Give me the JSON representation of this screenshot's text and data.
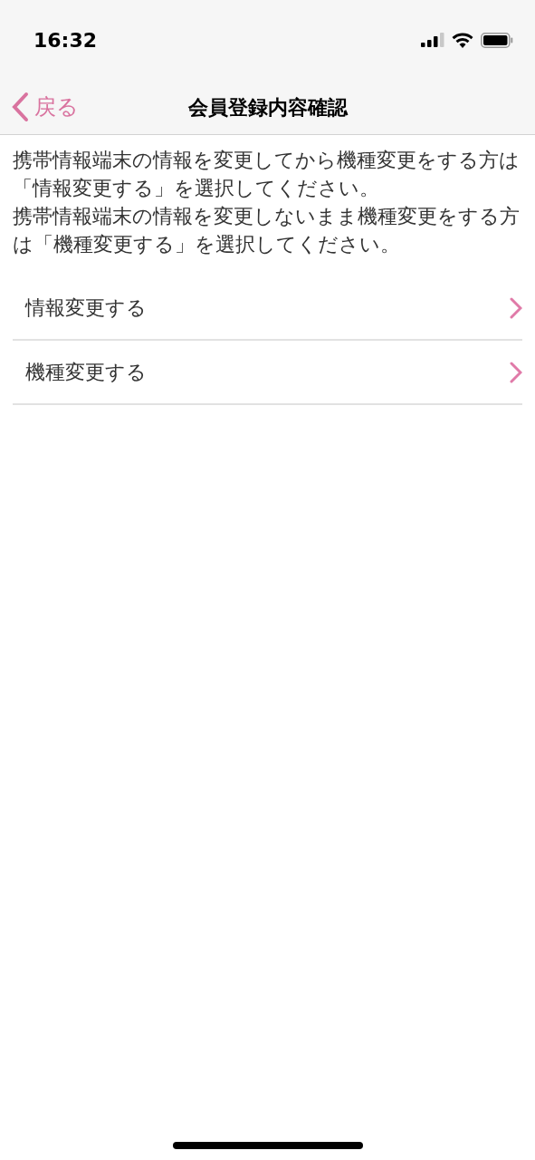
{
  "status_bar": {
    "time": "16:32"
  },
  "nav": {
    "back_label": "戻る",
    "title": "会員登録内容確認"
  },
  "description": [
    "携帯情報端末の情報を変更してから機種変更をする方は「情報変更する」を選択してください。",
    "携帯情報端末の情報を変更しないまま機種変更をする方は「機種変更する」を選択してください。"
  ],
  "options": [
    {
      "label": "情報変更する"
    },
    {
      "label": "機種変更する"
    }
  ]
}
